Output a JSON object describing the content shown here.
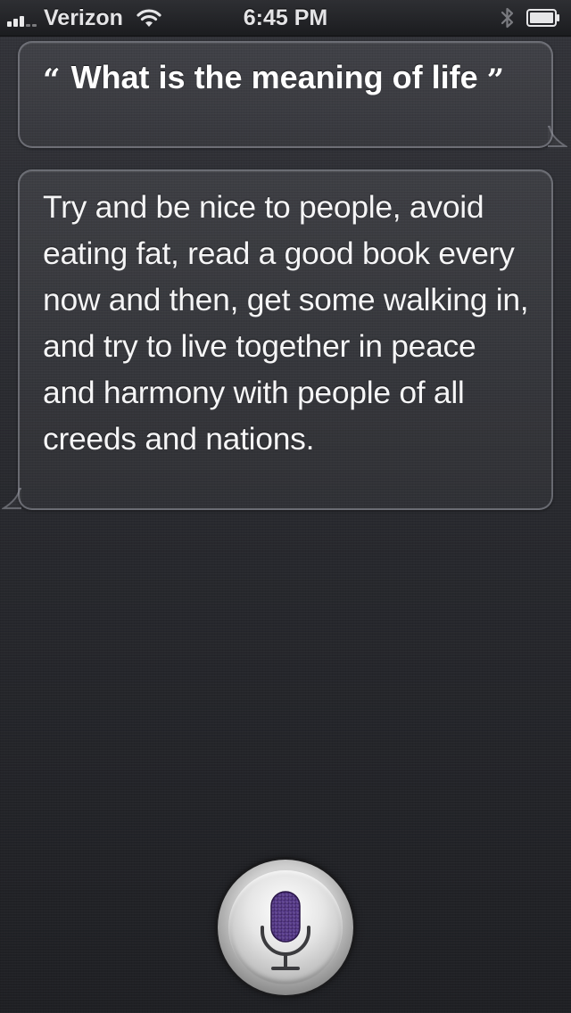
{
  "status_bar": {
    "carrier": "Verizon",
    "time": "6:45 PM",
    "signal_bars": 3,
    "signal_bars_total": 5,
    "icons": [
      "signal-icon",
      "wifi-icon",
      "bluetooth-icon",
      "battery-icon"
    ]
  },
  "conversation": {
    "query": {
      "open_quote": "“",
      "text": "What is the meaning of life",
      "close_quote": "”"
    },
    "answer": {
      "text": "Try and be nice to people, avoid eating fat, read a good book every now and then, get some walking in, and try to live together in peace and harmony with people of all creeds and nations."
    }
  },
  "mic_button": {
    "icon": "microphone-icon",
    "accent_color": "#4b2d7a"
  }
}
